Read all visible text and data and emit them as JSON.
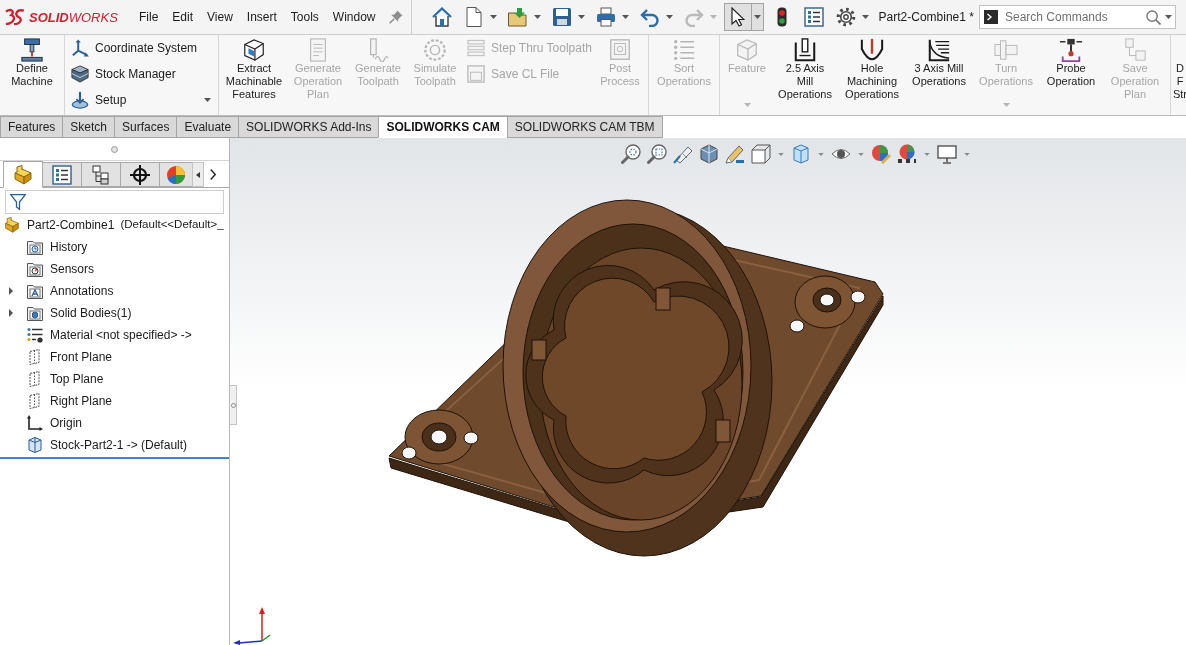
{
  "title_bar": {
    "logo": "**SOLID**WORKS",
    "menus": [
      "File",
      "Edit",
      "View",
      "Insert",
      "Tools",
      "Window"
    ],
    "quick_access": [
      {
        "disabled": false,
        "pressed": false
      },
      {
        "disabled": false,
        "pressed": false
      },
      {
        "disabled": false,
        "pressed": false
      },
      {
        "disabled": false,
        "pressed": false
      },
      {
        "disabled": false,
        "pressed": false
      },
      {
        "disabled": false,
        "pressed": false
      },
      {
        "disabled": true,
        "pressed": false
      },
      {
        "disabled": false,
        "pressed": true
      },
      {
        "disabled": false,
        "pressed": false
      },
      {
        "disabled": false,
        "pressed": false
      },
      {
        "disabled": false,
        "pressed": false
      }
    ],
    "document_title": "Part2-Combine1 *",
    "search": {
      "placeholder": "Search Commands"
    }
  },
  "ribbon": [
    {
      "items": [
        {
          "kind": "large",
          "label": "Define\nMachine",
          "disabled": false
        }
      ]
    },
    {
      "items": [
        {
          "kind": "small",
          "label": "Coordinate System",
          "disabled": false
        },
        {
          "kind": "small",
          "label": "Stock Manager",
          "disabled": false
        },
        {
          "kind": "small",
          "label": "Setup",
          "disabled": false,
          "dropdown": true
        }
      ]
    },
    {
      "items": [
        {
          "kind": "large",
          "label": "Extract\nMachinable\nFeatures",
          "disabled": false
        },
        {
          "kind": "large",
          "label": "Generate\nOperation\nPlan",
          "disabled": true
        },
        {
          "kind": "large",
          "label": "Generate\nToolpath",
          "disabled": true
        },
        {
          "kind": "large",
          "label": "Simulate\nToolpath",
          "disabled": true
        },
        {
          "kind": "small",
          "label": "Step Thru Toolpath",
          "disabled": true
        },
        {
          "kind": "small",
          "label": "Save CL File",
          "disabled": true
        },
        {
          "kind": "large",
          "label": "Post\nProcess",
          "disabled": true
        }
      ]
    },
    {
      "items": [
        {
          "kind": "large",
          "label": "Sort\nOperations",
          "disabled": true
        }
      ]
    },
    {
      "items": [
        {
          "kind": "large",
          "label": "Feature",
          "disabled": true,
          "dropdown": true
        },
        {
          "kind": "large",
          "label": "2.5 Axis\nMill\nOperations",
          "disabled": false
        },
        {
          "kind": "large",
          "label": "Hole\nMachining\nOperations",
          "disabled": false
        },
        {
          "kind": "large",
          "label": "3 Axis Mill\nOperations",
          "disabled": false
        },
        {
          "kind": "large",
          "label": "Turn\nOperations",
          "disabled": true,
          "dropdown": true
        },
        {
          "kind": "large",
          "label": "Probe\nOperation",
          "disabled": false
        },
        {
          "kind": "large",
          "label": "Save\nOperation\nPlan",
          "disabled": true
        }
      ]
    },
    {
      "items": [
        {
          "kind": "large",
          "label": "D\nF\nStr",
          "disabled": false
        }
      ]
    }
  ],
  "tabs": [
    {
      "label": "Features",
      "selected": false
    },
    {
      "label": "Sketch",
      "selected": false
    },
    {
      "label": "Surfaces",
      "selected": false
    },
    {
      "label": "Evaluate",
      "selected": false
    },
    {
      "label": "SOLIDWORKS Add-Ins",
      "selected": false
    },
    {
      "label": "SOLIDWORKS CAM",
      "selected": true
    },
    {
      "label": "SOLIDWORKS CAM TBM",
      "selected": false
    }
  ],
  "feature_manager": {
    "panel_tabs": [
      {
        "selected": true
      },
      {
        "selected": false
      },
      {
        "selected": false
      },
      {
        "selected": false
      },
      {
        "selected": false
      }
    ],
    "tree": {
      "label": "Part2-Combine1",
      "configuration": "(Default<<Default>_",
      "children": [
        {
          "kind": "history",
          "label": "History"
        },
        {
          "kind": "sensors",
          "label": "Sensors"
        },
        {
          "kind": "annotations",
          "label": "Annotations",
          "expanded": false
        },
        {
          "kind": "bodies",
          "label": "Solid Bodies(1)",
          "expanded": false
        },
        {
          "kind": "material",
          "label": "Material <not specified> ->"
        },
        {
          "kind": "plane",
          "label": "Front Plane"
        },
        {
          "kind": "plane",
          "label": "Top Plane"
        },
        {
          "kind": "plane",
          "label": "Right Plane"
        },
        {
          "kind": "origin",
          "label": "Origin"
        },
        {
          "kind": "stock",
          "label": "Stock-Part2-1 -> (Default)"
        }
      ]
    }
  }
}
